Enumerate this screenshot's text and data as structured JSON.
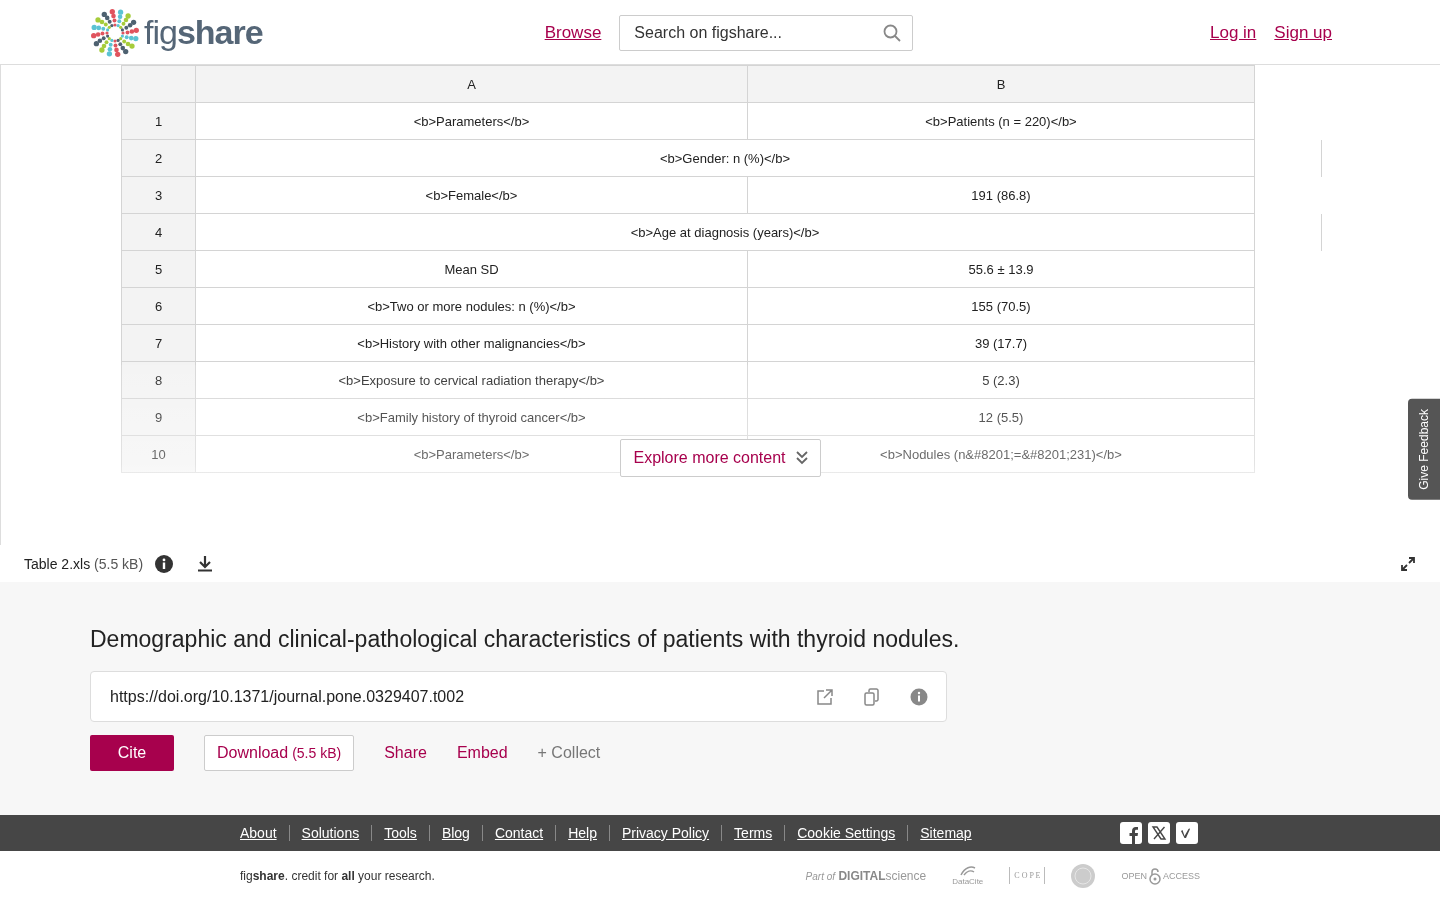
{
  "header": {
    "logo": "fig**share**",
    "nav": [
      {
        "label": "Browse"
      }
    ],
    "search": {
      "placeholder": "Search on figshare..."
    },
    "account": [
      {
        "label": "Log in"
      },
      {
        "label": "Sign up"
      }
    ]
  },
  "viewer": {
    "columns": [
      "A",
      "B"
    ],
    "rows": [
      {
        "number": "1",
        "kind": "pair",
        "cells": [
          "<b>Parameters</b>",
          "<b>Patients (n = 220)</b>"
        ]
      },
      {
        "number": "2",
        "kind": "merged",
        "cells": [
          {
            "text": "<b>Gender: n (%)</b>",
            "colspan": 2
          }
        ]
      },
      {
        "number": "3",
        "kind": "pair",
        "cells": [
          "<b>Female</b>",
          "191 (86.8)"
        ]
      },
      {
        "number": "4",
        "kind": "merged",
        "cells": [
          {
            "text": "<b>Age at diagnosis (years)</b>",
            "colspan": 2
          }
        ]
      },
      {
        "number": "5",
        "kind": "pair",
        "cells": [
          "Mean SD",
          "55.6 ± 13.9"
        ]
      },
      {
        "number": "6",
        "kind": "pair",
        "cells": [
          "<b>Two or more nodules: n (%)</b>",
          "155 (70.5)"
        ]
      },
      {
        "number": "7",
        "kind": "pair",
        "cells": [
          "<b>History with other malignancies</b>",
          "39 (17.7)"
        ]
      },
      {
        "number": "8",
        "kind": "pair",
        "cells": [
          "<b>Exposure to cervical radiation therapy</b>",
          "5 (2.3)"
        ]
      },
      {
        "number": "9",
        "kind": "pair",
        "cells": [
          "<b>Family history of thyroid cancer</b>",
          "12 (5.5)"
        ]
      },
      {
        "number": "10",
        "kind": "pair",
        "cells": [
          "<b>Parameters</b>",
          "<b>Nodules (n&#8201;=&#8201;231)</b>"
        ]
      }
    ],
    "explore_button": "Explore more content",
    "file": {
      "name": "Table 2.xls",
      "size": "(5.5 kB)"
    }
  },
  "feedback_tab": "Give Feedback",
  "details": {
    "title": "Demographic and clinical-pathological characteristics of patients with thyroid nodules.",
    "doi": "https://doi.org/10.1371/journal.pone.0329407.t002",
    "actions": [
      {
        "kind": "primary",
        "label": "Cite"
      },
      {
        "kind": "outline",
        "label": "Download",
        "size": "(5.5 kB)"
      },
      {
        "kind": "link",
        "label": "Share"
      },
      {
        "kind": "link",
        "label": "Embed"
      },
      {
        "kind": "muted",
        "label": "+ Collect"
      }
    ]
  },
  "footer": {
    "links": [
      "About",
      "Solutions",
      "Tools",
      "Blog",
      "Contact",
      "Help",
      "Privacy Policy",
      "Terms",
      "Cookie Settings",
      "Sitemap"
    ],
    "tagline": "fig**share**. credit for **all** your research.",
    "partners": [
      {
        "kind": "digital-science",
        "prefix": "Part of",
        "name": "DIGITAL",
        "suffix": "science"
      },
      {
        "kind": "datacite",
        "name": "DataCite"
      },
      {
        "kind": "cope",
        "name": "C O P E"
      },
      {
        "kind": "seal"
      },
      {
        "kind": "open-access",
        "name": "OPEN",
        "suffix": "ACCESS"
      }
    ]
  }
}
